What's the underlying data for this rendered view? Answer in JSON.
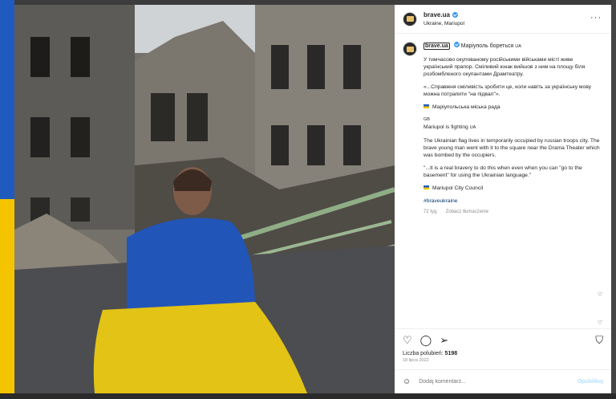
{
  "post": {
    "username": "brave.ua",
    "location": "Ukraine, Mariupol",
    "caption_headline": "Маріуполь бореться",
    "flag_mark": "UA",
    "uk_paragraph_1": "У тимчасово окупованому російськими військами місті живе український прапор. Сміливий юнак вийшов з ним на площу біля розбомбленого окупантами Драмтеатру.",
    "uk_paragraph_2": "«...Справжня сміливість зробити це, коли навіть за українську мову можна потрапити \"на підвал\"».",
    "uk_source": "Маріупольська міська рада",
    "gb_mark": "GB",
    "en_headline": "Mariupol is fighting",
    "en_paragraph_1": "The Ukrainian flag lives in temporarily occupied by russian troops city. The brave young man went with it to the square near the Drama Theater which was bombed by the occupiers.",
    "en_paragraph_2": "\"...It is a real bravery to do this when even when you can \"go to the basement\" for using the Ukrainian language.\"",
    "en_source": "Mariupol City Council",
    "hashtag": "#braveukraine",
    "age": "72 tyg.",
    "translate_label": "Zobacz tłumaczenie",
    "likes_label": "Liczba polubień:",
    "likes_count": "5198",
    "date": "18 lipca 2022",
    "comment_placeholder": "Dodaj komentarz...",
    "publish_label": "Opublikuj"
  },
  "icons": {
    "heart": "heart-icon",
    "comment": "comment-icon",
    "share": "share-icon",
    "bookmark": "bookmark-icon",
    "emoji": "emoji-icon",
    "more": "more-options-icon"
  },
  "colors": {
    "flag_blue": "#1f5bbf",
    "flag_yellow": "#f5c400",
    "link": "#00376b",
    "verified": "#3897f0"
  }
}
